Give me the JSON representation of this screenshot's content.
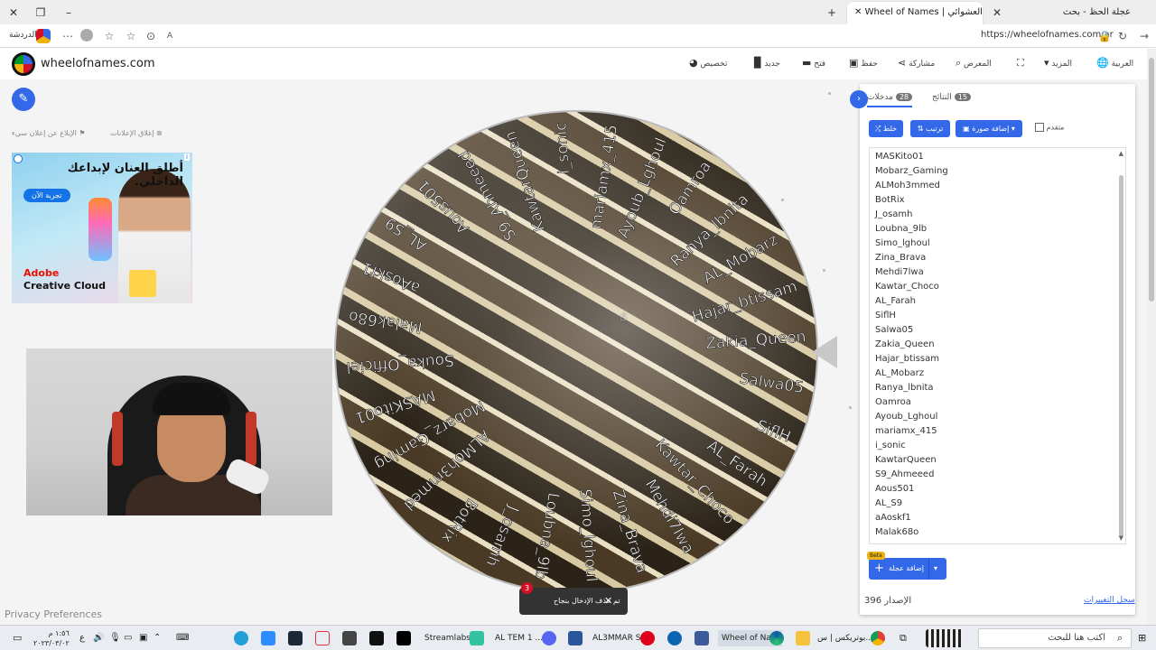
{
  "browser": {
    "tabs": [
      {
        "label": "عجلة الحظ - بحث",
        "active": false
      },
      {
        "label": "Wheel of Names | عم العشوائي",
        "active": true
      }
    ],
    "url": "https://wheelofnames.com/ar",
    "profile_label": "الدردشة"
  },
  "header": {
    "site_name": "wheelofnames.com",
    "nav": [
      {
        "label": "تخصيص",
        "icon": "palette-icon"
      },
      {
        "label": "جديد",
        "icon": "new-document-icon"
      },
      {
        "label": "فتح",
        "icon": "folder-icon"
      },
      {
        "label": "حفظ",
        "icon": "save-icon"
      },
      {
        "label": "مشاركة",
        "icon": "share-icon"
      },
      {
        "label": "المعرض",
        "icon": "search-icon"
      },
      {
        "label": "",
        "icon": "fullscreen-icon"
      },
      {
        "label": "المزيد",
        "icon": "chevron-down-icon"
      },
      {
        "label": "العربية",
        "icon": "globe-icon"
      }
    ]
  },
  "ads": {
    "report_label": "الإبلاغ عن إعلان سيء",
    "close_label": "إغلاق الإعلانات",
    "headline": "أطلق العنان لإبداعك الداخلي.",
    "cta": "تجربة الآن",
    "brand_line1": "Adobe",
    "brand_line2": "Creative Cloud",
    "chip": "i"
  },
  "privacy_label": "Privacy Preferences",
  "wheel": {
    "labels": [
      "Zakia_Queen",
      "Hajar_btissam",
      "AL_Mobarz",
      "Ranya_lbnita",
      "Oamroa",
      "Ayoub_Lghoul",
      "mariamx_415",
      "i_sonic",
      "KawtarQueen",
      "S9_Ahmeeed",
      "Aous501",
      "AL_S9",
      "aAoskf1",
      "Malak68o",
      "Souka_Officiel",
      "MASKito01",
      "Mobarz_Gaming",
      "ALMoh3mmed",
      "BotRix",
      "J_osamh",
      "Loubna_9lb",
      "Simo_lghoul",
      "Zina_Brava",
      "Mehdi7lwa",
      "Kawtar_Choco",
      "AL_Farah",
      "SiflH",
      "Salwa05"
    ]
  },
  "toast": {
    "message": "تم حذف الإدخال بنجاح",
    "badge": "3",
    "close": "✕"
  },
  "panel": {
    "tabs": {
      "entries": {
        "label": "مدخلات",
        "count": "28"
      },
      "results": {
        "label": "النتائج",
        "count": "15"
      }
    },
    "buttons": {
      "shuffle": "خلط",
      "sort": "ترتيب",
      "add_image": "إضافة صورة"
    },
    "advanced_label": "متقدم",
    "entries": [
      "MASKito01",
      "Mobarz_Gaming",
      "ALMoh3mmed",
      "BotRix",
      "J_osamh",
      "Loubna_9lb",
      "Simo_lghoul",
      "Zina_Brava",
      "Mehdi7lwa",
      "Kawtar_Choco",
      "AL_Farah",
      "SiflH",
      "Salwa05",
      "Zakia_Queen",
      "Hajar_btissam",
      "AL_Mobarz",
      "Ranya_lbnita",
      "Oamroa",
      "Ayoub_Lghoul",
      "mariamx_415",
      "i_sonic",
      "KawtarQueen",
      "S9_Ahmeeed",
      "Aous501",
      "AL_S9",
      "aAoskf1",
      "Malak68o"
    ],
    "add_wheel_label": "إضافة عجلة",
    "beta_label": "Beta",
    "version_label": "الإصدار",
    "version_value": "396",
    "changelog_label": "سجل التغييرات"
  },
  "taskbar": {
    "search_placeholder": "اكتب هنا للبحث",
    "clock_time": "١:٥٦ م",
    "clock_date": "٢٠٢٣/٠٣/٠٢",
    "items": [
      "بوتريكس | س...",
      "Wheel of Na...",
      "AL3MMAR S...",
      "AL TEM 1 ...",
      "Streamlabs ..."
    ]
  }
}
